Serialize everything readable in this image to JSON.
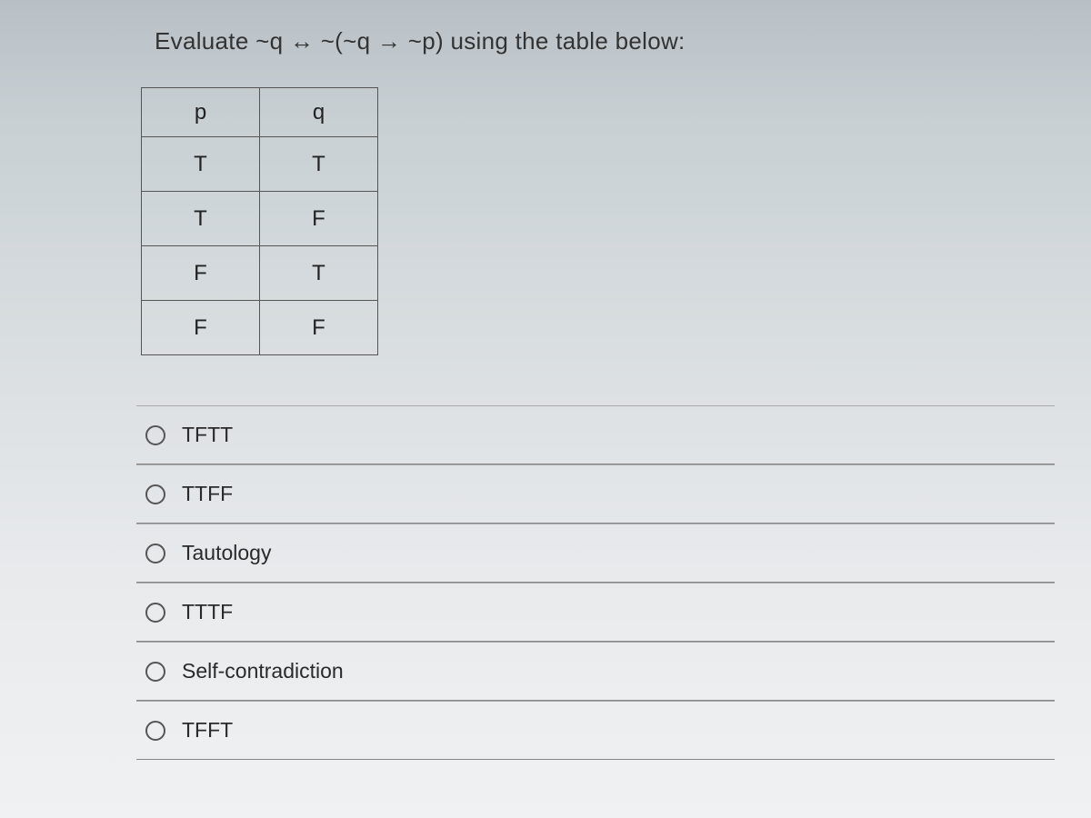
{
  "question": "Evaluate ~q ↔ ~(~q → ~p) using the table below:",
  "table": {
    "headers": [
      "p",
      "q"
    ],
    "rows": [
      [
        "T",
        "T"
      ],
      [
        "T",
        "F"
      ],
      [
        "F",
        "T"
      ],
      [
        "F",
        "F"
      ]
    ]
  },
  "options": [
    {
      "label": "TFTT"
    },
    {
      "label": "TTFF"
    },
    {
      "label": "Tautology"
    },
    {
      "label": "TTTF"
    },
    {
      "label": "Self-contradiction"
    },
    {
      "label": "TFFT"
    }
  ]
}
